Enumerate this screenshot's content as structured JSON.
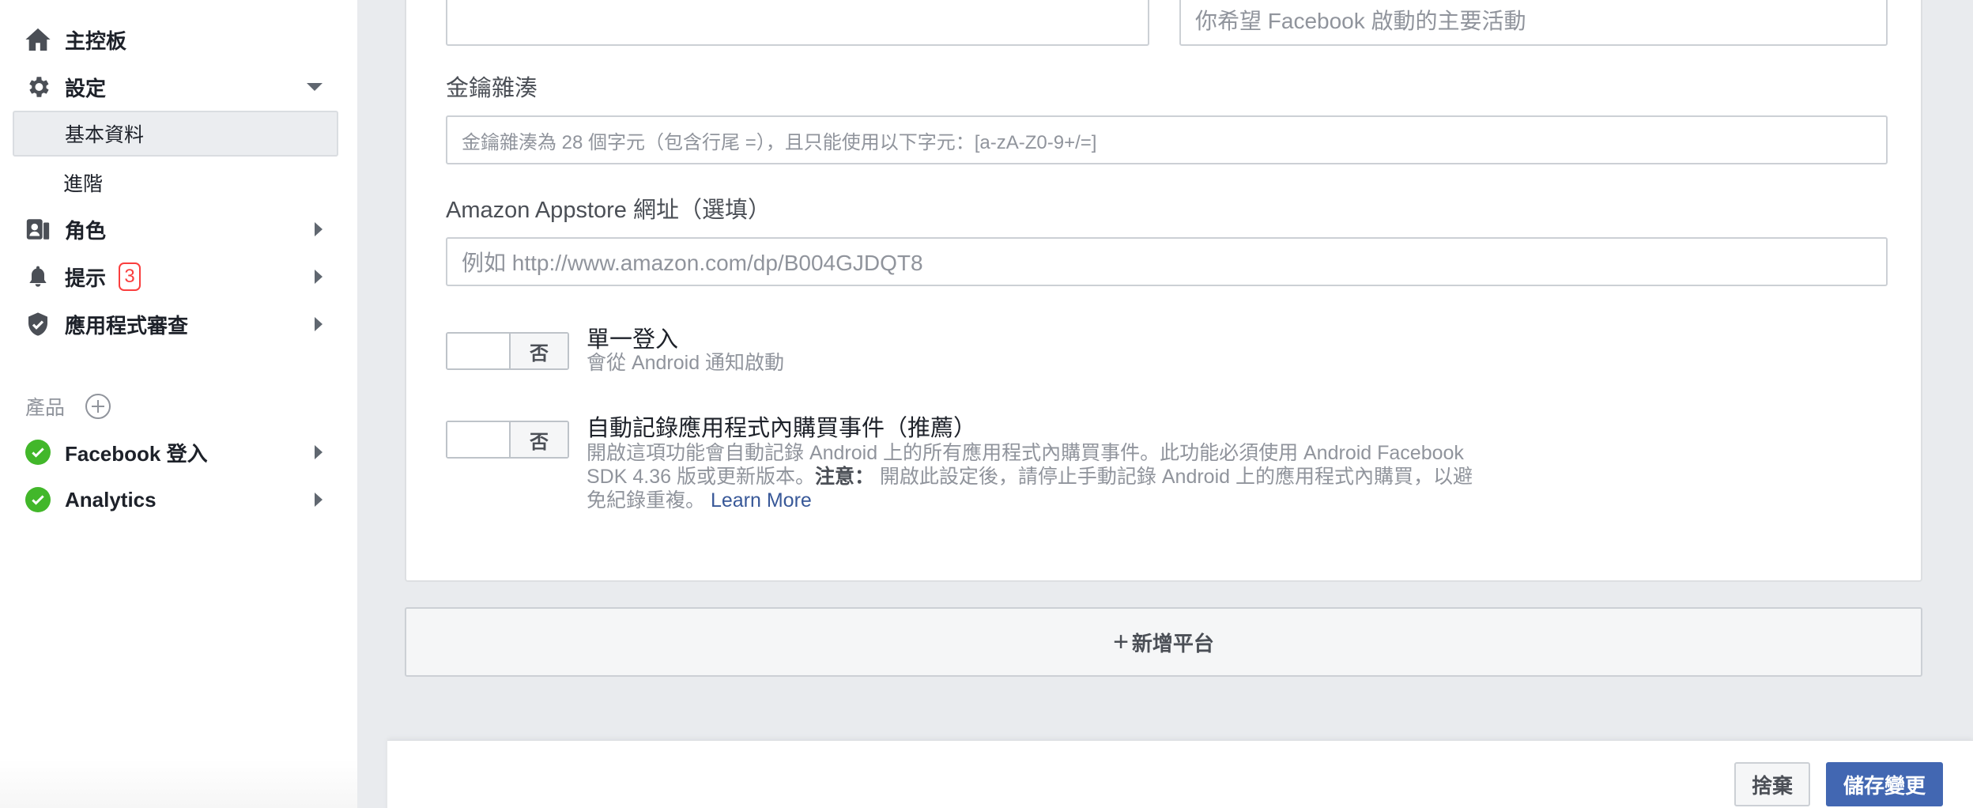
{
  "sidebar": {
    "dashboard": "主控板",
    "settings": "設定",
    "settings_sub": [
      "基本資料",
      "進階"
    ],
    "roles": "角色",
    "alerts": "提示",
    "alerts_count": "3",
    "app_review": "應用程式審查",
    "products_label": "產品",
    "products": [
      "Facebook 登入",
      "Analytics"
    ]
  },
  "form": {
    "top_left_value": "",
    "top_right_placeholder": "你希望 Facebook 啟動的主要活動",
    "key_hash_label": "金鑰雜湊",
    "key_hash_placeholder": "金鑰雜湊為 28 個字元（包含行尾 =），且只能使用以下字元：[a-zA-Z0-9+/=]",
    "amazon_label": "Amazon Appstore 網址（選填）",
    "amazon_placeholder": "例如 http://www.amazon.com/dp/B004GJDQT8",
    "sso_toggle": "否",
    "sso_title": "單一登入",
    "sso_desc": "會從 Android 通知啟動",
    "iap_toggle": "否",
    "iap_title": "自動記錄應用程式內購買事件（推薦）",
    "iap_desc_1": "開啟這項功能會自動記錄 Android 上的所有應用程式內購買事件。此功能必須使用 Android Facebook",
    "iap_desc_2a": "SDK 4.36 版或更新版本。",
    "iap_desc_note": "注意：",
    "iap_desc_2b": " 開啟此設定後，請停止手動記錄 Android 上的應用程式內購買，以避",
    "iap_desc_3": "免紀錄重複。",
    "learn_more": "Learn More"
  },
  "add_platform": "新增平台",
  "footer": {
    "cancel": "捨棄",
    "save": "儲存變更"
  },
  "colors": {
    "accent": "#4267b2",
    "success": "#42b72a",
    "badge": "#fa3e3e"
  }
}
